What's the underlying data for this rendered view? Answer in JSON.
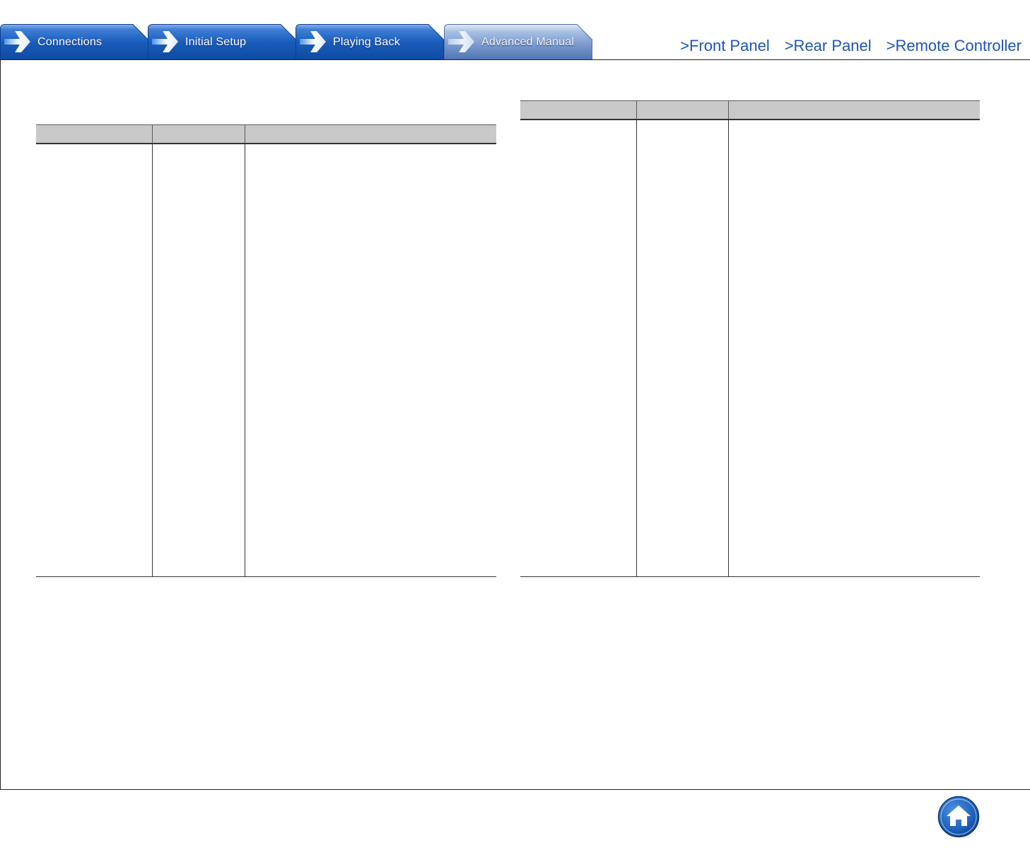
{
  "nav": {
    "tabs": [
      {
        "label": "Connections",
        "active": false
      },
      {
        "label": "Initial Setup",
        "active": false
      },
      {
        "label": "Playing Back",
        "active": false
      },
      {
        "label": "Advanced Manual",
        "active": true
      }
    ]
  },
  "quick_links": {
    "front_panel": ">Front Panel",
    "rear_panel": ">Rear Panel",
    "remote_controller": ">Remote Controller"
  },
  "colors": {
    "tab_blue": "#1659b4",
    "tab_active": "#6f8fc4",
    "link_blue": "#1f55b7",
    "header_gray": "#c9c9c9",
    "home_blue": "#1b5fb8"
  },
  "icons": {
    "tab_arrow": "arrow-right-icon",
    "home": "home-icon"
  },
  "tables": {
    "left": {
      "headers": [
        "",
        "",
        ""
      ],
      "rows": [
        [
          "",
          "",
          ""
        ]
      ]
    },
    "right": {
      "headers": [
        "",
        "",
        ""
      ],
      "rows": [
        [
          "",
          "",
          ""
        ]
      ]
    }
  }
}
